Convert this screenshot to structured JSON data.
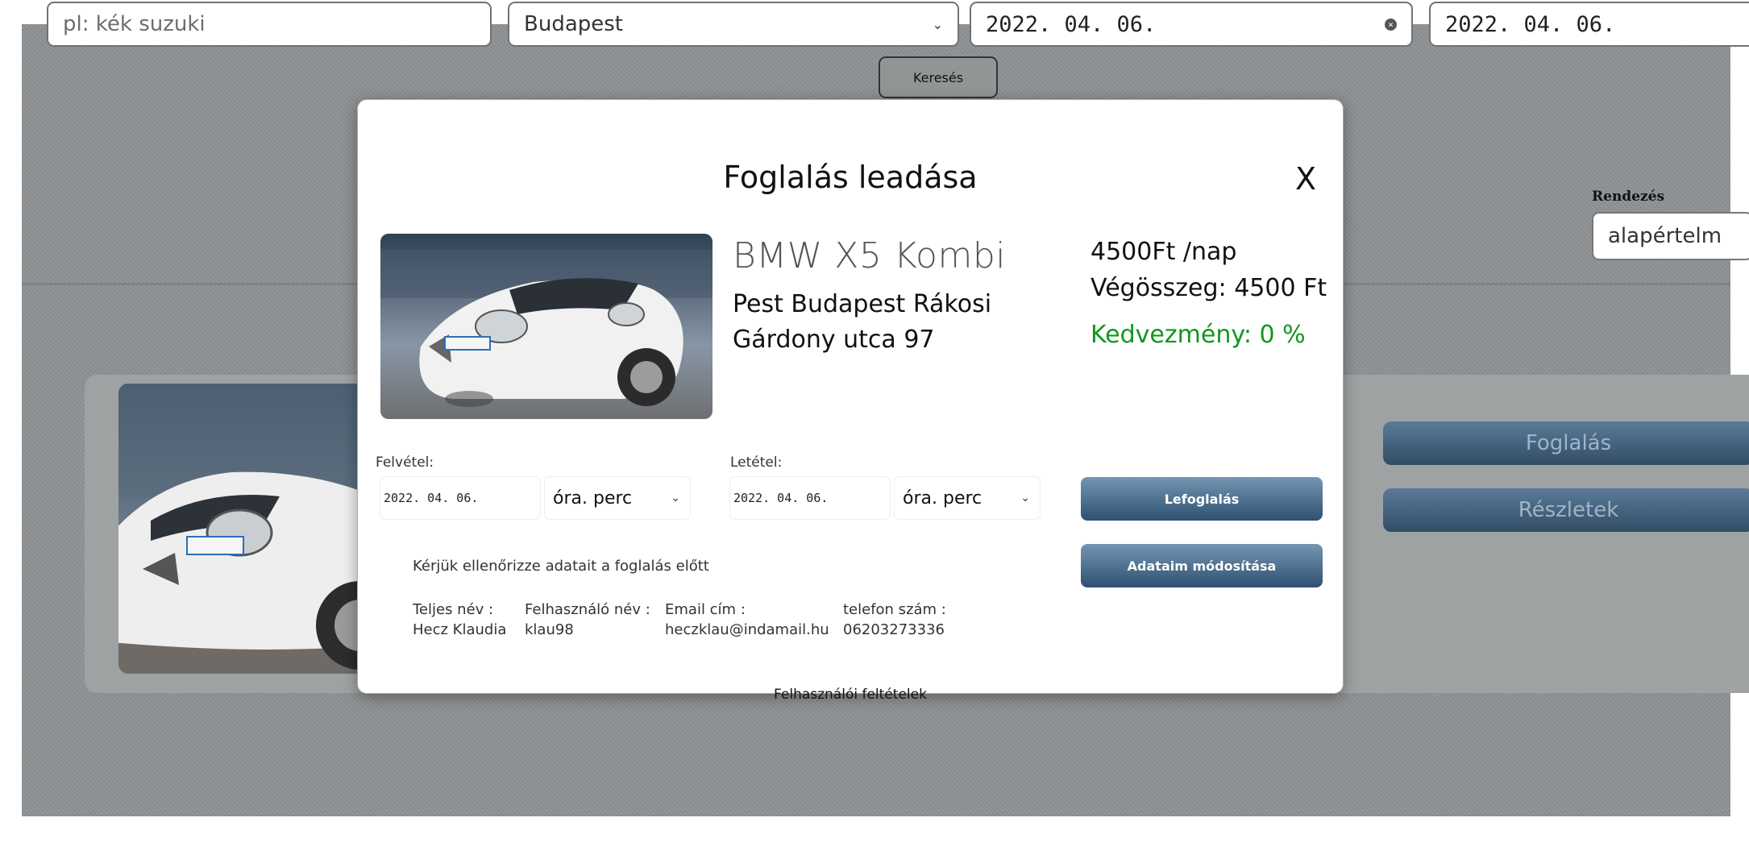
{
  "search": {
    "keyword_placeholder": "pl: kék suzuki",
    "city": "Budapest",
    "date_from": "2022. 04. 06.",
    "date_to": "2022. 04. 06.",
    "search_button": "Keresés"
  },
  "sort": {
    "label": "Rendezés",
    "value": "alapértelm"
  },
  "listing": {
    "reserve_button": "Foglalás",
    "details_button": "Részletek"
  },
  "modal": {
    "title": "Foglalás leadása",
    "close": "X",
    "car_name": "BMW X5 Kombi",
    "address": "Pest Budapest Rákosi Gárdony utca 97",
    "price": "4500Ft /nap",
    "total": "Végösszeg: 4500 Ft",
    "discount": "Kedvezmény: 0 %",
    "pickup_label": "Felvétel:",
    "pickup_date": "2022. 04. 06.",
    "pickup_time": "óra. perc",
    "dropoff_label": "Letétel:",
    "dropoff_date": "2022. 04. 06.",
    "dropoff_time": "óra. perc",
    "book_button": "Lefoglalás",
    "edit_button": "Adataim módosítása",
    "check_notice": "Kérjük ellenőrizze adatait a foglalás előtt",
    "user": {
      "fullname_label": "Teljes név :",
      "fullname": "Hecz Klaudia",
      "username_label": "Felhasználó név :",
      "username": "klau98",
      "email_label": "Email cím :",
      "email": "heczklau@indamail.hu",
      "phone_label": "telefon szám :",
      "phone": "06203273336"
    },
    "terms": "Felhasználói feltételek"
  }
}
